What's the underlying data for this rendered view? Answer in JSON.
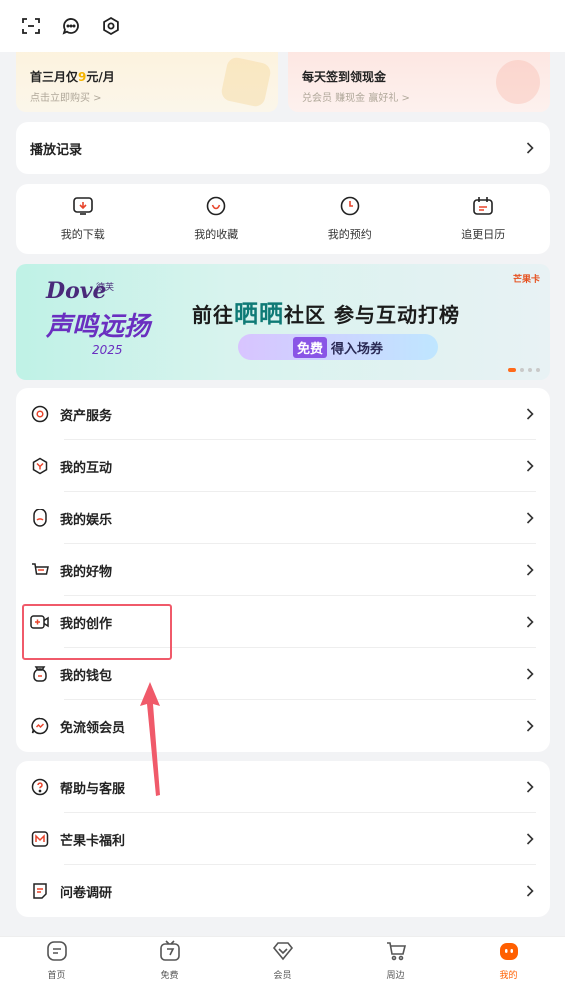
{
  "header": {
    "icons": [
      "scan-icon",
      "message-icon",
      "settings-icon"
    ]
  },
  "promos": [
    {
      "title_pre": "首三月仅",
      "title_hl": "9",
      "title_post": "元/月",
      "sub": "点击立即购买 >"
    },
    {
      "title": "每天签到领现金",
      "sub": "兑会员 赚现金 赢好礼 >"
    }
  ],
  "history": {
    "label": "播放记录"
  },
  "quick": [
    {
      "label": "我的下载",
      "icon": "download-icon"
    },
    {
      "label": "我的收藏",
      "icon": "heart-icon"
    },
    {
      "label": "我的预约",
      "icon": "clock-icon"
    },
    {
      "label": "追更日历",
      "icon": "calendar-icon"
    }
  ],
  "banner": {
    "logo_brand": "Dove",
    "logo_small": "德芙",
    "logo_title": "声鸣远扬",
    "logo_year": "2025",
    "main_pre": "前往",
    "main_hl": "晒晒",
    "main_post": "社区 参与互动打榜",
    "pill_hl": "免费",
    "pill_text": "得入场券",
    "brand": "芒果卡"
  },
  "menu1": [
    {
      "label": "资产服务",
      "icon": "asset-icon"
    },
    {
      "label": "我的互动",
      "icon": "interaction-icon"
    },
    {
      "label": "我的娱乐",
      "icon": "entertainment-icon"
    },
    {
      "label": "我的好物",
      "icon": "goods-icon"
    },
    {
      "label": "我的创作",
      "icon": "creation-icon"
    },
    {
      "label": "我的钱包",
      "icon": "wallet-icon"
    },
    {
      "label": "免流领会员",
      "icon": "free-data-icon"
    }
  ],
  "menu2": [
    {
      "label": "帮助与客服",
      "icon": "help-icon"
    },
    {
      "label": "芒果卡福利",
      "icon": "mango-card-icon"
    },
    {
      "label": "问卷调研",
      "icon": "survey-icon"
    }
  ],
  "tabs": [
    {
      "label": "首页",
      "icon": "home-icon"
    },
    {
      "label": "免费",
      "icon": "free-tv-icon"
    },
    {
      "label": "会员",
      "icon": "vip-icon"
    },
    {
      "label": "周边",
      "icon": "cart-icon"
    },
    {
      "label": "我的",
      "icon": "profile-icon"
    }
  ],
  "colors": {
    "accent": "#ff5f00",
    "highlight": "#f05a6a"
  }
}
